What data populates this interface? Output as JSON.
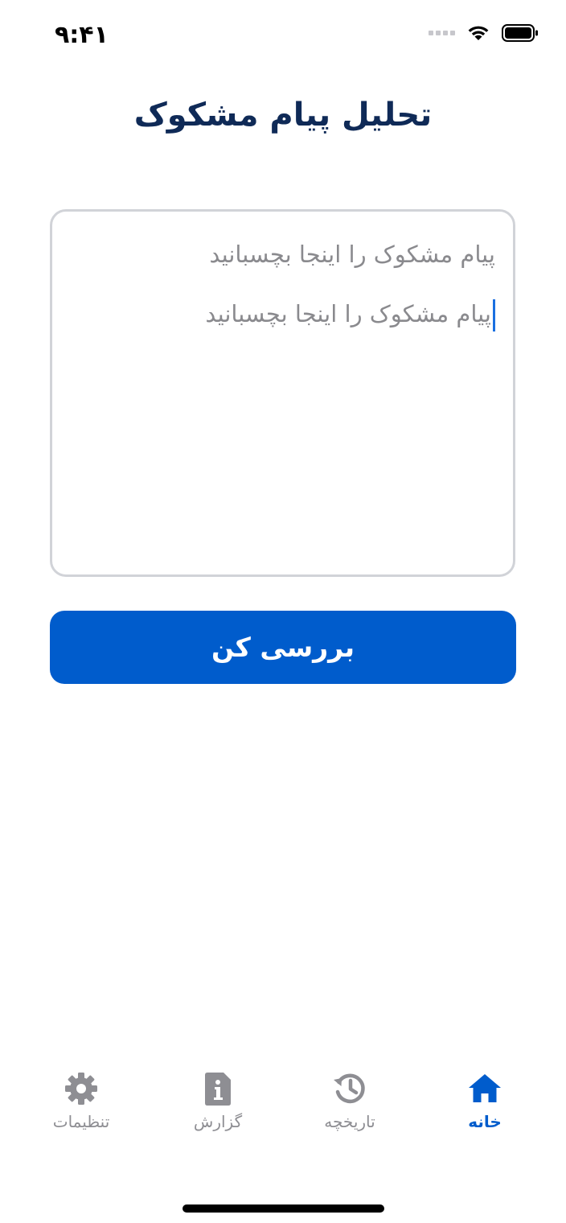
{
  "status_bar": {
    "time": "۹:۴۱",
    "icons": [
      "signal-icon",
      "wifi-icon",
      "battery-icon"
    ]
  },
  "header": {
    "title": "تحلیل پیام مشکوک"
  },
  "message_input": {
    "placeholder": "پیام مشکوک را اینجا بچسبانید",
    "value": "پیام مشکوک را اینجا بچسبانید"
  },
  "check_button": {
    "label": "بررسی کن"
  },
  "tab_bar": {
    "active": "home",
    "tabs": [
      {
        "id": "home",
        "label": "خانه",
        "icon": "home-icon"
      },
      {
        "id": "history",
        "label": "تاریخچه",
        "icon": "history-icon"
      },
      {
        "id": "report",
        "label": "گزارش",
        "icon": "report-icon"
      },
      {
        "id": "settings",
        "label": "تنظیمات",
        "icon": "gear-icon"
      }
    ]
  },
  "colors": {
    "primary": "#005ccc",
    "title": "#0f2a57",
    "inactive": "#8e8e93",
    "border": "#d1d3d8"
  }
}
